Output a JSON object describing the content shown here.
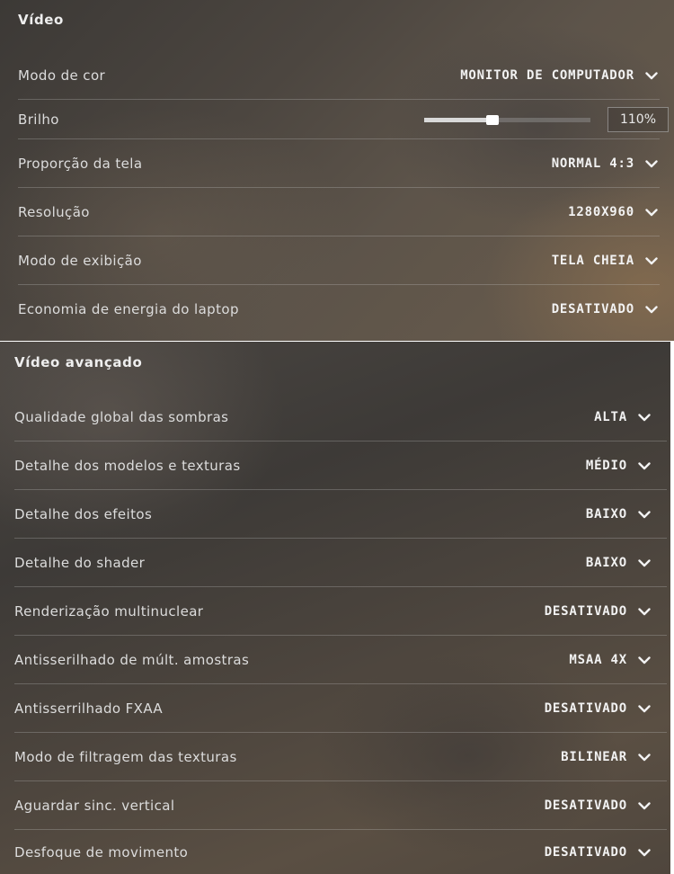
{
  "video": {
    "title": "Vídeo",
    "rows": [
      {
        "label": "Modo de cor",
        "value": "MONITOR DE COMPUTADOR"
      },
      {
        "label": "Brilho",
        "value": "110%",
        "slider_fraction": 0.41
      },
      {
        "label": "Proporção da tela",
        "value": "NORMAL 4:3"
      },
      {
        "label": "Resolução",
        "value": "1280X960"
      },
      {
        "label": "Modo de exibição",
        "value": "TELA CHEIA"
      },
      {
        "label": "Economia de energia do laptop",
        "value": "DESATIVADO"
      }
    ]
  },
  "advanced": {
    "title": "Vídeo avançado",
    "rows": [
      {
        "label": "Qualidade global das sombras",
        "value": "ALTA"
      },
      {
        "label": "Detalhe dos modelos e texturas",
        "value": "MÉDIO"
      },
      {
        "label": "Detalhe dos efeitos",
        "value": "BAIXO"
      },
      {
        "label": "Detalhe do shader",
        "value": "BAIXO"
      },
      {
        "label": "Renderização multinuclear",
        "value": "DESATIVADO"
      },
      {
        "label": "Antisserilhado de múlt. amostras",
        "value": "MSAA 4X"
      },
      {
        "label": "Antisserrilhado FXAA",
        "value": "DESATIVADO"
      },
      {
        "label": "Modo de filtragem das texturas",
        "value": "BILINEAR"
      },
      {
        "label": "Aguardar sinc. vertical",
        "value": "DESATIVADO"
      },
      {
        "label": "Desfoque de movimento",
        "value": "DESATIVADO"
      }
    ]
  },
  "icons": {
    "dropdown": "chevron-down-icon"
  },
  "colors": {
    "text": "#f2f2f2",
    "label": "#dcdcdc",
    "divider": "#8c8c8c"
  }
}
